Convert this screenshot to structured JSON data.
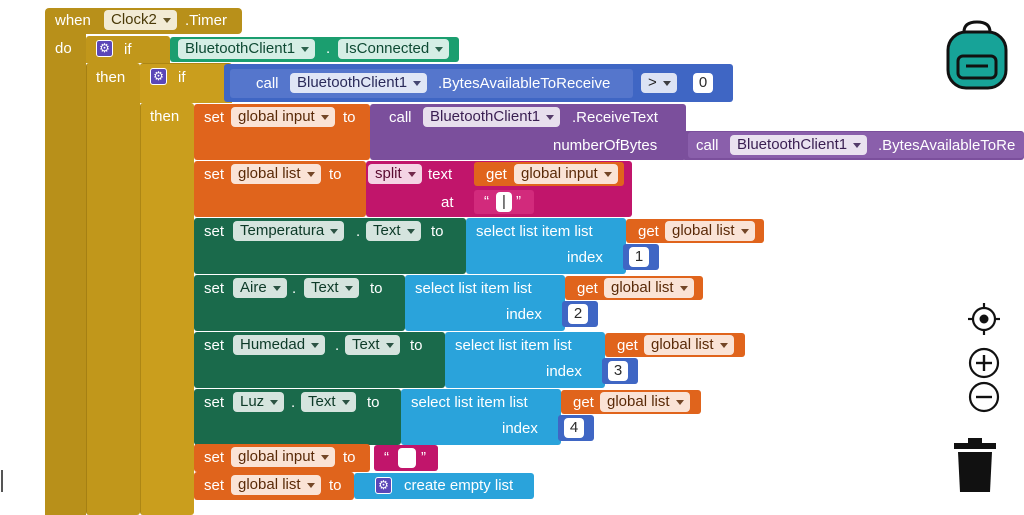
{
  "colors": {
    "control": "#b8901a",
    "logic": "#1b9e6f",
    "bluetooth": "#3f66c4",
    "math_compare": "#3f66c4",
    "variable": "#e0641c",
    "text": "#c1156b",
    "component_set": "#1a6a4b",
    "list": "#2aa3db",
    "component_call": "#7b4f9c",
    "backpack": "#17a398"
  },
  "event": {
    "when_label": "when",
    "component": "Clock2",
    "event_name": ".Timer",
    "do_label": "do"
  },
  "if_outer": {
    "if_label": "if",
    "condition_component": "BluetoothClient1",
    "dot": ".",
    "condition_property": "IsConnected",
    "then_label": "then"
  },
  "if_inner": {
    "if_label": "if",
    "then_label": "then",
    "call_label": "call",
    "component": "BluetoothClient1",
    "method": ".BytesAvailableToReceive",
    "operator": ">",
    "value": "0"
  },
  "stmt_set_input": {
    "set_label": "set",
    "variable": "global input",
    "to_label": "to",
    "call_label": "call",
    "component": "BluetoothClient1",
    "method": ".ReceiveText",
    "param_label": "numberOfBytes",
    "arg_call_label": "call",
    "arg_component": "BluetoothClient1",
    "arg_method": ".BytesAvailableToRe"
  },
  "stmt_set_list": {
    "set_label": "set",
    "variable": "global list",
    "to_label": "to",
    "split_label": "split",
    "text_label": "text",
    "get_label": "get",
    "get_variable": "global input",
    "at_label": "at",
    "quote_open": "“",
    "separator": "|",
    "quote_close": "”"
  },
  "stmt_component_sets": [
    {
      "set_label": "set",
      "component": "Temperatura",
      "dot": ".",
      "property": "Text",
      "to_label": "to",
      "select_label": "select list item  list",
      "get_label": "get",
      "get_variable": "global list",
      "index_label": "index",
      "index": "1"
    },
    {
      "set_label": "set",
      "component": "Aire",
      "dot": ".",
      "property": "Text",
      "to_label": "to",
      "select_label": "select list item  list",
      "get_label": "get",
      "get_variable": "global list",
      "index_label": "index",
      "index": "2"
    },
    {
      "set_label": "set",
      "component": "Humedad",
      "dot": ".",
      "property": "Text",
      "to_label": "to",
      "select_label": "select list item  list",
      "get_label": "get",
      "get_variable": "global list",
      "index_label": "index",
      "index": "3"
    },
    {
      "set_label": "set",
      "component": "Luz",
      "dot": ".",
      "property": "Text",
      "to_label": "to",
      "select_label": "select list item  list",
      "get_label": "get",
      "get_variable": "global list",
      "index_label": "index",
      "index": "4"
    }
  ],
  "stmt_reset_input": {
    "set_label": "set",
    "variable": "global input",
    "to_label": "to",
    "quote_open": "“",
    "quote_close": "”"
  },
  "stmt_reset_list": {
    "set_label": "set",
    "variable": "global list",
    "to_label": "to",
    "create_label": "create empty list"
  },
  "workspace_controls": {
    "backpack_icon": "backpack-icon",
    "center_icon": "target-icon",
    "zoom_in_icon": "zoom-in-icon",
    "zoom_out_icon": "zoom-out-icon",
    "trash_icon": "trash-icon"
  }
}
